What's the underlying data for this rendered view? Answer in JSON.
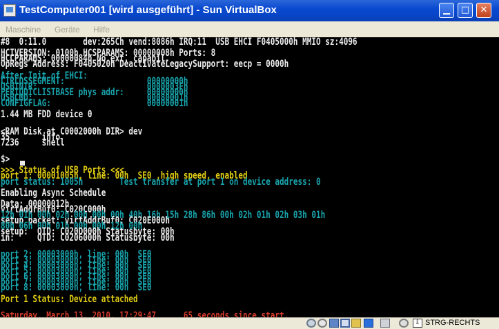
{
  "window": {
    "title": "TestComputer001 [wird ausgeführt] - Sun VirtualBox"
  },
  "menu": [
    "Maschine",
    "Geräte",
    "Hilfe"
  ],
  "console": [
    {
      "text": "#8  0:11.0        dev:265Ch vend:8086h IRQ:11  USB EHCI F0405000h MMIO sz:4096",
      "color": "w"
    },
    {
      "text": "",
      "color": "w"
    },
    {
      "text": "HCIVERSION: 0100h HCSPARAMS: 00000008h Ports: 8",
      "color": "w"
    },
    {
      "text": "HCCPARAMS: 00000084h No ext. capabil.",
      "color": "w"
    },
    {
      "text": "OpRegs Address: F0405020h DeactivateLegacySupport: eecp = 0000h",
      "color": "w"
    },
    {
      "text": "",
      "color": "w"
    },
    {
      "text": "After Init of EHCI:",
      "color": "c"
    },
    {
      "text": "CTRLDSSEGMENT:                  00000000h",
      "color": "c"
    },
    {
      "text": "USBINTR:                        0000003Fh",
      "color": "c"
    },
    {
      "text": "PERIODICLISTBASE phys addr:     00000000h",
      "color": "c"
    },
    {
      "text": "USBCMD:                         00080001h",
      "color": "c"
    },
    {
      "text": "CONFIGFLAG:                     00000001h",
      "color": "c"
    },
    {
      "text": "",
      "color": "w"
    },
    {
      "text": "1.44 MB FDD device 0",
      "color": "w"
    },
    {
      "text": "",
      "color": "w"
    },
    {
      "text": "",
      "color": "w"
    },
    {
      "text": "<RAM Disk at C0002000h DIR> dev",
      "color": "w"
    },
    {
      "text": "35       info",
      "color": "w"
    },
    {
      "text": "7236     shell",
      "color": "w"
    },
    {
      "text": "",
      "color": "w"
    },
    {
      "text": "",
      "color": "w"
    },
    {
      "text": "$>",
      "color": "w"
    },
    {
      "text": "",
      "color": "w"
    },
    {
      "text": ">>> Status of USB Ports <<<",
      "color": "y"
    },
    {
      "text": "port 1: 00001005h, line: 00h  SE0 ,high speed, enabled",
      "color": "y"
    },
    {
      "text": "port status: 1005h        Test transfer at port 1 on device address: 0",
      "color": "c"
    },
    {
      "text": "",
      "color": "w"
    },
    {
      "text": "Enabling Async Schedule",
      "color": "w"
    },
    {
      "text": "",
      "color": "w"
    },
    {
      "text": "Data: 00000012h",
      "color": "w"
    },
    {
      "text": "virtAddrBuf0: C020C000h",
      "color": "w"
    },
    {
      "text": "12h 01h 00h 02h 00h 00h 00h 40h 16h 15h 28h 86h 00h 02h 01h 02h 03h 01h",
      "color": "c"
    },
    {
      "text": "setup packet: virtAddrBuf0: C020E000h",
      "color": "w"
    },
    {
      "text": "80h 06h 00h 01h 00h 00h 12h 00h",
      "color": "c"
    },
    {
      "text": "setup:  QTD: C020D000h Statusbyte: 00h",
      "color": "w"
    },
    {
      "text": "in:     QTD: C0206000h Statusbyte: 00h",
      "color": "w"
    },
    {
      "text": "",
      "color": "w"
    },
    {
      "text": "",
      "color": "w"
    },
    {
      "text": "port 2: 00003000h, line: 00h  SE0",
      "color": "c"
    },
    {
      "text": "port 3: 00003000h, line: 00h  SE0",
      "color": "c"
    },
    {
      "text": "port 4: 00003000h, line: 00h  SE0",
      "color": "c"
    },
    {
      "text": "port 5: 00003000h, line: 00h  SE0",
      "color": "c"
    },
    {
      "text": "port 6: 00003000h, line: 00h  SE0",
      "color": "c"
    },
    {
      "text": "port 7: 00003000h, line: 00h  SE0",
      "color": "c"
    },
    {
      "text": "port 8: 00003000h, line: 00h  SE0",
      "color": "c"
    },
    {
      "text": "",
      "color": "w"
    },
    {
      "text": "Port 1 Status: Device attached",
      "color": "y"
    },
    {
      "text": "",
      "color": "w"
    },
    {
      "text": "",
      "color": "w"
    },
    {
      "text": "Saturday, March 13, 2010, 17:29:47      65 seconds since start.",
      "color": "r"
    }
  ],
  "statusbar": {
    "host_key": "STRG-RECHTS",
    "icons": [
      "harddisk-icon",
      "cdrom-icon",
      "network-icon",
      "usb-icon",
      "shared-folders-icon",
      "display-icon",
      "capture-icon",
      "mouse-integration-icon",
      "host-key-icon"
    ]
  },
  "colors": {
    "white": "#ebebeb",
    "cyan": "#18a4ac",
    "yellow": "#e0cc12",
    "red": "#d33a2b",
    "titlebar": "#0a4ad0"
  }
}
